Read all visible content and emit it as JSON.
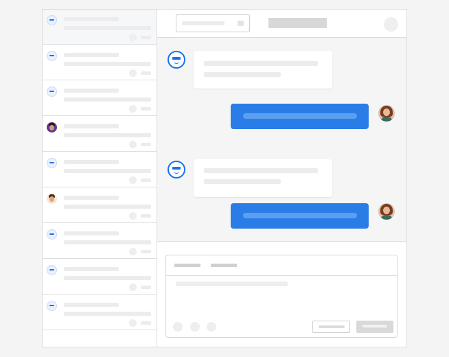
{
  "colors": {
    "accent": "#1a73e8",
    "outgoing_bubble": "#2a7de7",
    "background": "#f4f4f5"
  },
  "conversations": [
    {
      "avatar": "bot-icon",
      "active": true
    },
    {
      "avatar": "bot-icon"
    },
    {
      "avatar": "bot-icon"
    },
    {
      "avatar": "person-avatar"
    },
    {
      "avatar": "bot-icon"
    },
    {
      "avatar": "person-avatar"
    },
    {
      "avatar": "bot-icon"
    },
    {
      "avatar": "bot-icon"
    },
    {
      "avatar": "bot-icon"
    }
  ],
  "messages": [
    {
      "from": "bot",
      "avatar": "bot-icon"
    },
    {
      "from": "user",
      "avatar": "user-avatar"
    },
    {
      "from": "bot",
      "avatar": "bot-icon"
    },
    {
      "from": "user",
      "avatar": "user-avatar"
    }
  ],
  "composer": {
    "tabs": 2,
    "format_icons": [
      "emoji-icon",
      "attach-icon",
      "image-icon"
    ],
    "buttons": [
      "secondary-button",
      "send-button"
    ]
  }
}
